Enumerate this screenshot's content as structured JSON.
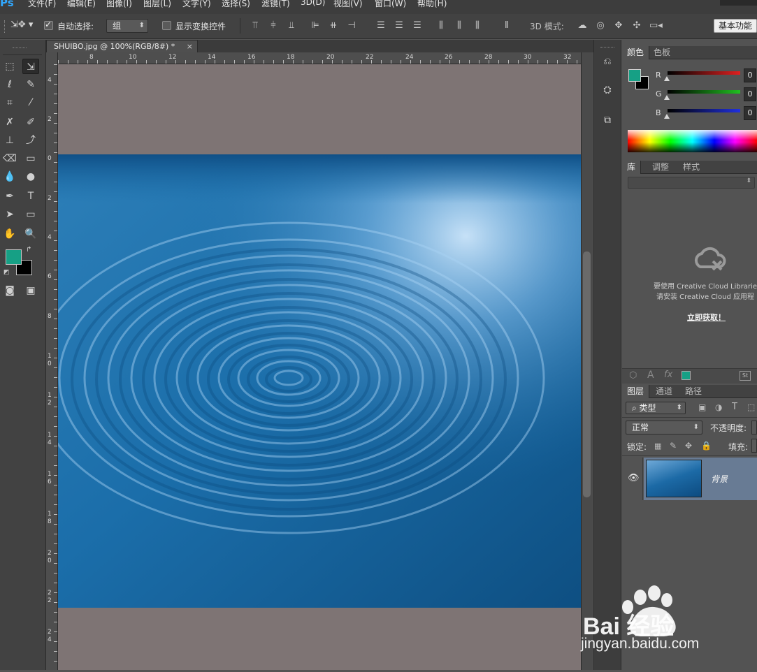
{
  "menubar": {
    "logo": "Ps",
    "items": [
      "文件(F)",
      "编辑(E)",
      "图像(I)",
      "图层(L)",
      "文字(Y)",
      "选择(S)",
      "滤镜(T)",
      "3D(D)",
      "视图(V)",
      "窗口(W)",
      "帮助(H)"
    ]
  },
  "options": {
    "auto_select_label": "自动选择:",
    "auto_select_value": "组",
    "show_transform_label": "显示变换控件",
    "mode_3d_label": "3D 模式:",
    "workspace_button": "基本功能"
  },
  "document": {
    "tab_title": "SHUIBO.jpg @ 100%(RGB/8#) *",
    "tab_close": "×",
    "h_ruler_ticks": [
      "8",
      "10",
      "12",
      "14",
      "16",
      "18",
      "20",
      "22",
      "24",
      "26",
      "28",
      "30",
      "32"
    ],
    "v_ruler_ticks": [
      "4",
      "2",
      "0",
      "2",
      "4",
      "6",
      "8",
      "1 0",
      "1 2",
      "1 4",
      "1 6",
      "1 8",
      "2 0",
      "2 2",
      "2 4"
    ]
  },
  "color_panel": {
    "tabs": [
      "颜色",
      "色板"
    ],
    "foreground": "#16a085",
    "background": "#000000",
    "channels": [
      {
        "label": "R",
        "value": "0",
        "color": "#e02020"
      },
      {
        "label": "G",
        "value": "0",
        "color": "#20c020"
      },
      {
        "label": "B",
        "value": "0",
        "color": "#2030e0"
      }
    ]
  },
  "library_panel": {
    "tabs": [
      "库",
      "调整",
      "样式"
    ],
    "message_line1": "要使用 Creative Cloud Libraries",
    "message_line2": "请安装 Creative Cloud 应用程",
    "link": "立即获取！"
  },
  "layers_panel": {
    "tabs": [
      "图层",
      "通道",
      "路径"
    ],
    "filter_kind": "类型",
    "blend_mode": "正常",
    "opacity_label": "不透明度:",
    "lock_label": "锁定:",
    "fill_label": "填充:",
    "layers": [
      {
        "name": "背景",
        "visible": true
      }
    ]
  },
  "watermark": {
    "brand": "Bai 经验",
    "url": "jingyan.baidu.com"
  }
}
